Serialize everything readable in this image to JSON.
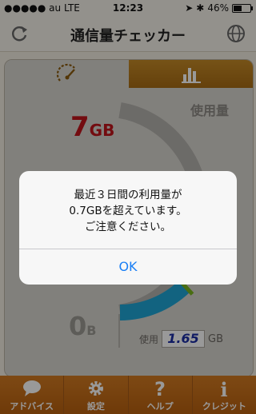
{
  "status_bar": {
    "carrier": "●●●●● au  LTE",
    "time": "12:23",
    "battery_percent": "46%",
    "battery_level": 0.46
  },
  "nav": {
    "title": "通信量チェッカー",
    "left_icon": "refresh-icon",
    "right_icon": "globe-icon"
  },
  "tabs": [
    {
      "icon": "gauge-icon",
      "selected": true
    },
    {
      "icon": "bar-chart-icon",
      "selected": false
    }
  ],
  "gauge": {
    "max_value": "7",
    "max_unit": "GB",
    "min_value": "0",
    "min_unit": "B",
    "usage_title": "使用量",
    "usage_prefix": "使用",
    "usage_value": "1.65",
    "usage_unit": "GB",
    "used_fraction": 0.236,
    "accent_color": "#1ea5d6",
    "marker_color": "#7bb61e",
    "max_color": "#c0141c"
  },
  "alert": {
    "line1": "最近３日間の利用量が",
    "line2": "0.7GBを超えています。",
    "line3": "ご注意ください。",
    "ok_label": "OK"
  },
  "tabbar": {
    "items": [
      {
        "label": "アドバイス",
        "icon": "chat-bubble-icon"
      },
      {
        "label": "設定",
        "icon": "gear-icon"
      },
      {
        "label": "ヘルプ",
        "icon": "question-icon"
      },
      {
        "label": "クレジット",
        "icon": "info-icon"
      }
    ]
  }
}
